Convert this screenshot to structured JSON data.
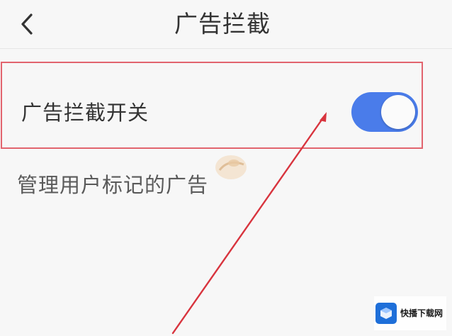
{
  "header": {
    "title": "广告拦截",
    "back_icon": "chevron-left-icon"
  },
  "ad_block_setting": {
    "label": "广告拦截开关",
    "enabled": true,
    "toggle_color": "#4a7cea"
  },
  "manage_link": {
    "label": "管理用户标记的广告"
  },
  "annotation": {
    "highlight_color": "#e2646e",
    "arrow_color": "#d8343e"
  },
  "watermark": {
    "name": "快播下载网"
  }
}
